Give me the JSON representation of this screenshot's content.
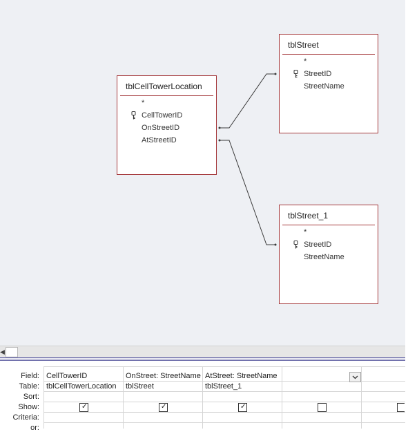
{
  "tables": {
    "cell_tower": {
      "title": "tblCellTowerLocation",
      "fields": [
        "*",
        "CellTowerID",
        "OnStreetID",
        "AtStreetID"
      ]
    },
    "street": {
      "title": "tblStreet",
      "fields": [
        "*",
        "StreetID",
        "StreetName"
      ]
    },
    "street_1": {
      "title": "tblStreet_1",
      "fields": [
        "*",
        "StreetID",
        "StreetName"
      ]
    }
  },
  "grid": {
    "row_labels": [
      "Field:",
      "Table:",
      "Sort:",
      "Show:",
      "Criteria:",
      "or:"
    ],
    "columns": [
      {
        "field": "CellTowerID",
        "table": "tblCellTowerLocation",
        "show": true
      },
      {
        "field": "OnStreet: StreetName",
        "table": "tblStreet",
        "show": true
      },
      {
        "field": "AtStreet: StreetName",
        "table": "tblStreet_1",
        "show": true
      },
      {
        "field": "",
        "table": "",
        "show": false
      }
    ]
  },
  "icons": {
    "key": "primary-key-icon",
    "dropdown": "chevron-down-icon",
    "scroll_left": "scroll-left-arrow-icon"
  },
  "colors": {
    "table_border": "#a4373a",
    "canvas": "#eef0f4",
    "link_line": "#3a3a3a"
  }
}
